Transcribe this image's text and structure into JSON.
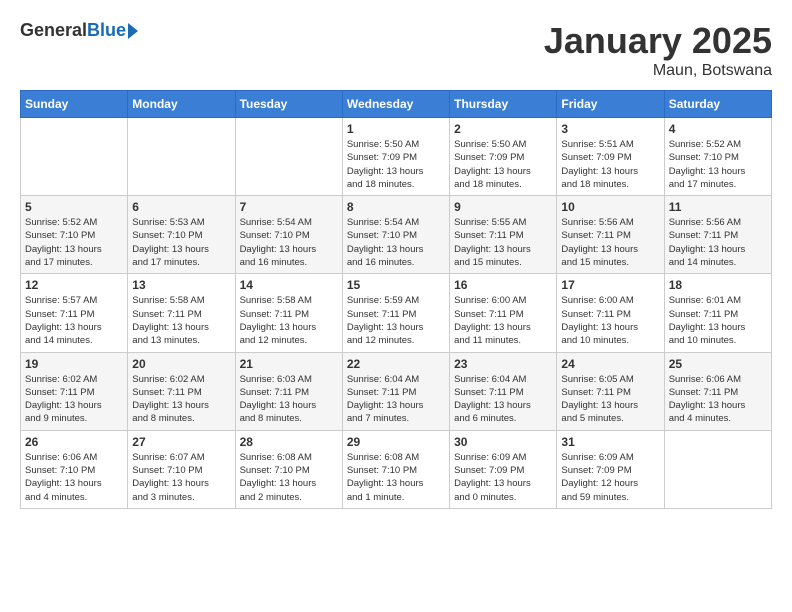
{
  "header": {
    "logo_general": "General",
    "logo_blue": "Blue",
    "month_title": "January 2025",
    "location": "Maun, Botswana"
  },
  "weekdays": [
    "Sunday",
    "Monday",
    "Tuesday",
    "Wednesday",
    "Thursday",
    "Friday",
    "Saturday"
  ],
  "rows": [
    [
      {
        "day": "",
        "info": ""
      },
      {
        "day": "",
        "info": ""
      },
      {
        "day": "",
        "info": ""
      },
      {
        "day": "1",
        "info": "Sunrise: 5:50 AM\nSunset: 7:09 PM\nDaylight: 13 hours\nand 18 minutes."
      },
      {
        "day": "2",
        "info": "Sunrise: 5:50 AM\nSunset: 7:09 PM\nDaylight: 13 hours\nand 18 minutes."
      },
      {
        "day": "3",
        "info": "Sunrise: 5:51 AM\nSunset: 7:09 PM\nDaylight: 13 hours\nand 18 minutes."
      },
      {
        "day": "4",
        "info": "Sunrise: 5:52 AM\nSunset: 7:10 PM\nDaylight: 13 hours\nand 17 minutes."
      }
    ],
    [
      {
        "day": "5",
        "info": "Sunrise: 5:52 AM\nSunset: 7:10 PM\nDaylight: 13 hours\nand 17 minutes."
      },
      {
        "day": "6",
        "info": "Sunrise: 5:53 AM\nSunset: 7:10 PM\nDaylight: 13 hours\nand 17 minutes."
      },
      {
        "day": "7",
        "info": "Sunrise: 5:54 AM\nSunset: 7:10 PM\nDaylight: 13 hours\nand 16 minutes."
      },
      {
        "day": "8",
        "info": "Sunrise: 5:54 AM\nSunset: 7:10 PM\nDaylight: 13 hours\nand 16 minutes."
      },
      {
        "day": "9",
        "info": "Sunrise: 5:55 AM\nSunset: 7:11 PM\nDaylight: 13 hours\nand 15 minutes."
      },
      {
        "day": "10",
        "info": "Sunrise: 5:56 AM\nSunset: 7:11 PM\nDaylight: 13 hours\nand 15 minutes."
      },
      {
        "day": "11",
        "info": "Sunrise: 5:56 AM\nSunset: 7:11 PM\nDaylight: 13 hours\nand 14 minutes."
      }
    ],
    [
      {
        "day": "12",
        "info": "Sunrise: 5:57 AM\nSunset: 7:11 PM\nDaylight: 13 hours\nand 14 minutes."
      },
      {
        "day": "13",
        "info": "Sunrise: 5:58 AM\nSunset: 7:11 PM\nDaylight: 13 hours\nand 13 minutes."
      },
      {
        "day": "14",
        "info": "Sunrise: 5:58 AM\nSunset: 7:11 PM\nDaylight: 13 hours\nand 12 minutes."
      },
      {
        "day": "15",
        "info": "Sunrise: 5:59 AM\nSunset: 7:11 PM\nDaylight: 13 hours\nand 12 minutes."
      },
      {
        "day": "16",
        "info": "Sunrise: 6:00 AM\nSunset: 7:11 PM\nDaylight: 13 hours\nand 11 minutes."
      },
      {
        "day": "17",
        "info": "Sunrise: 6:00 AM\nSunset: 7:11 PM\nDaylight: 13 hours\nand 10 minutes."
      },
      {
        "day": "18",
        "info": "Sunrise: 6:01 AM\nSunset: 7:11 PM\nDaylight: 13 hours\nand 10 minutes."
      }
    ],
    [
      {
        "day": "19",
        "info": "Sunrise: 6:02 AM\nSunset: 7:11 PM\nDaylight: 13 hours\nand 9 minutes."
      },
      {
        "day": "20",
        "info": "Sunrise: 6:02 AM\nSunset: 7:11 PM\nDaylight: 13 hours\nand 8 minutes."
      },
      {
        "day": "21",
        "info": "Sunrise: 6:03 AM\nSunset: 7:11 PM\nDaylight: 13 hours\nand 8 minutes."
      },
      {
        "day": "22",
        "info": "Sunrise: 6:04 AM\nSunset: 7:11 PM\nDaylight: 13 hours\nand 7 minutes."
      },
      {
        "day": "23",
        "info": "Sunrise: 6:04 AM\nSunset: 7:11 PM\nDaylight: 13 hours\nand 6 minutes."
      },
      {
        "day": "24",
        "info": "Sunrise: 6:05 AM\nSunset: 7:11 PM\nDaylight: 13 hours\nand 5 minutes."
      },
      {
        "day": "25",
        "info": "Sunrise: 6:06 AM\nSunset: 7:11 PM\nDaylight: 13 hours\nand 4 minutes."
      }
    ],
    [
      {
        "day": "26",
        "info": "Sunrise: 6:06 AM\nSunset: 7:10 PM\nDaylight: 13 hours\nand 4 minutes."
      },
      {
        "day": "27",
        "info": "Sunrise: 6:07 AM\nSunset: 7:10 PM\nDaylight: 13 hours\nand 3 minutes."
      },
      {
        "day": "28",
        "info": "Sunrise: 6:08 AM\nSunset: 7:10 PM\nDaylight: 13 hours\nand 2 minutes."
      },
      {
        "day": "29",
        "info": "Sunrise: 6:08 AM\nSunset: 7:10 PM\nDaylight: 13 hours\nand 1 minute."
      },
      {
        "day": "30",
        "info": "Sunrise: 6:09 AM\nSunset: 7:09 PM\nDaylight: 13 hours\nand 0 minutes."
      },
      {
        "day": "31",
        "info": "Sunrise: 6:09 AM\nSunset: 7:09 PM\nDaylight: 12 hours\nand 59 minutes."
      },
      {
        "day": "",
        "info": ""
      }
    ]
  ]
}
